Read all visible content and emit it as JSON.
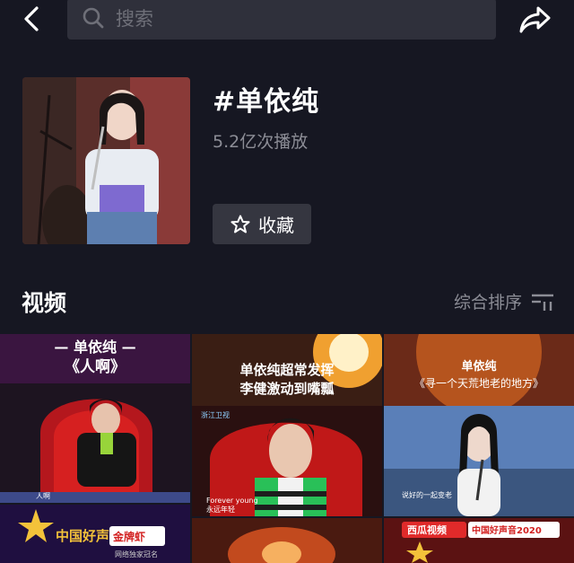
{
  "search": {
    "placeholder": "搜索"
  },
  "topic": {
    "title": "#单依纯",
    "play_count": "5.2亿次播放",
    "favorite_label": "收藏"
  },
  "videos_section": {
    "title": "视频",
    "sort_label": "综合排序"
  },
  "thumbnails": [
    {
      "line1": "— 单依纯 —",
      "line2": "《人啊》",
      "caption": "人啊"
    },
    {
      "line1": "单依纯超常发挥",
      "line2": "李健激动到嘴瓢",
      "caption": "Forever young",
      "caption2": "永远年轻",
      "channel": "浙江卫视"
    },
    {
      "line1": "单依纯",
      "line2": "《寻一个天荒地老的地方》",
      "caption": "说好的一起变老"
    },
    {
      "brand": "中国好声音",
      "sponsor": "金牌虾",
      "sponsor_sub": "网络独家冠名"
    },
    {},
    {
      "platform": "西瓜视频",
      "brand": "中国好声音2020"
    }
  ],
  "colors": {
    "background": "#161722",
    "search_bg": "#2f303b",
    "button_bg": "#353640",
    "muted_text": "#8c8d96"
  }
}
